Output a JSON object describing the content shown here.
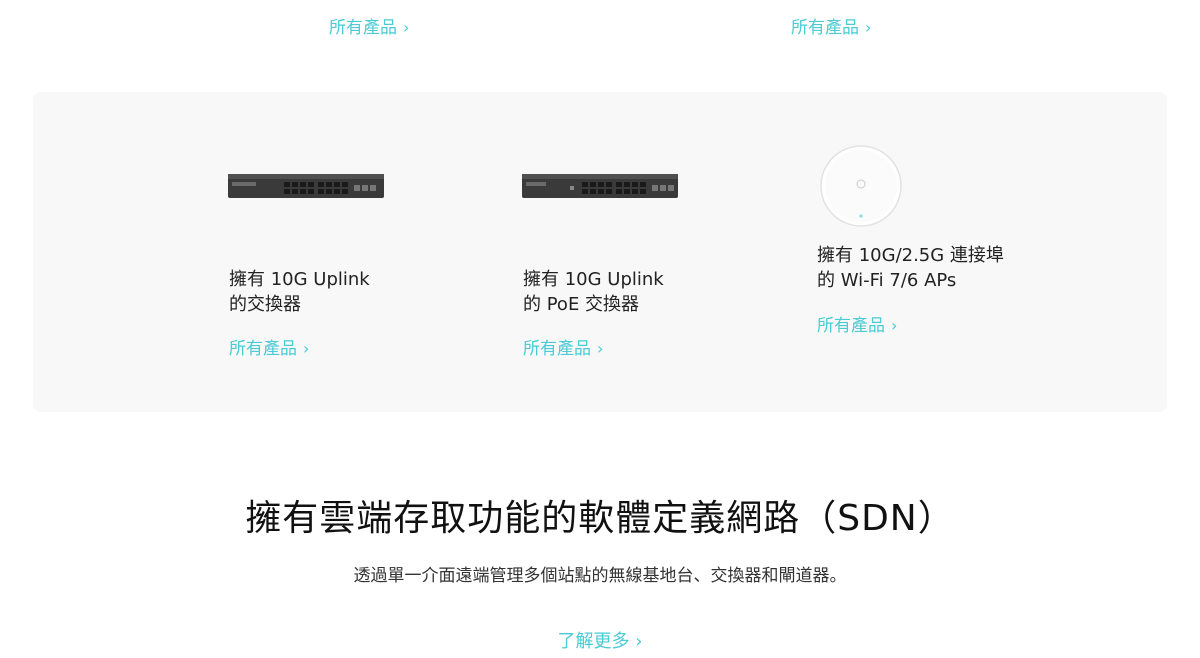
{
  "top_links": [
    {
      "label": "所有產品",
      "chevron": "›"
    },
    {
      "label": "所有產品",
      "chevron": "›"
    }
  ],
  "cards": [
    {
      "title_line1": "擁有 10G Uplink",
      "title_line2": "的交換器",
      "link": "所有產品",
      "chevron": "›",
      "image": "rack-switch-image"
    },
    {
      "title_line1": "擁有 10G Uplink",
      "title_line2": "的 PoE 交換器",
      "link": "所有產品",
      "chevron": "›",
      "image": "poe-switch-image"
    },
    {
      "title_line1": "擁有 10G/2.5G 連接埠",
      "title_line2": "的 Wi-Fi 7/6 APs",
      "link": "所有產品",
      "chevron": "›",
      "image": "ceiling-ap-image"
    }
  ],
  "sdn": {
    "title": "擁有雲端存取功能的軟體定義網路（SDN）",
    "subtitle": "透過單一介面遠端管理多個站點的無線基地台、交換器和閘道器。",
    "link": "了解更多",
    "chevron": "›"
  },
  "colors": {
    "accent": "#4acbd6",
    "panel_bg": "#f8f8f8",
    "text": "#222222"
  }
}
